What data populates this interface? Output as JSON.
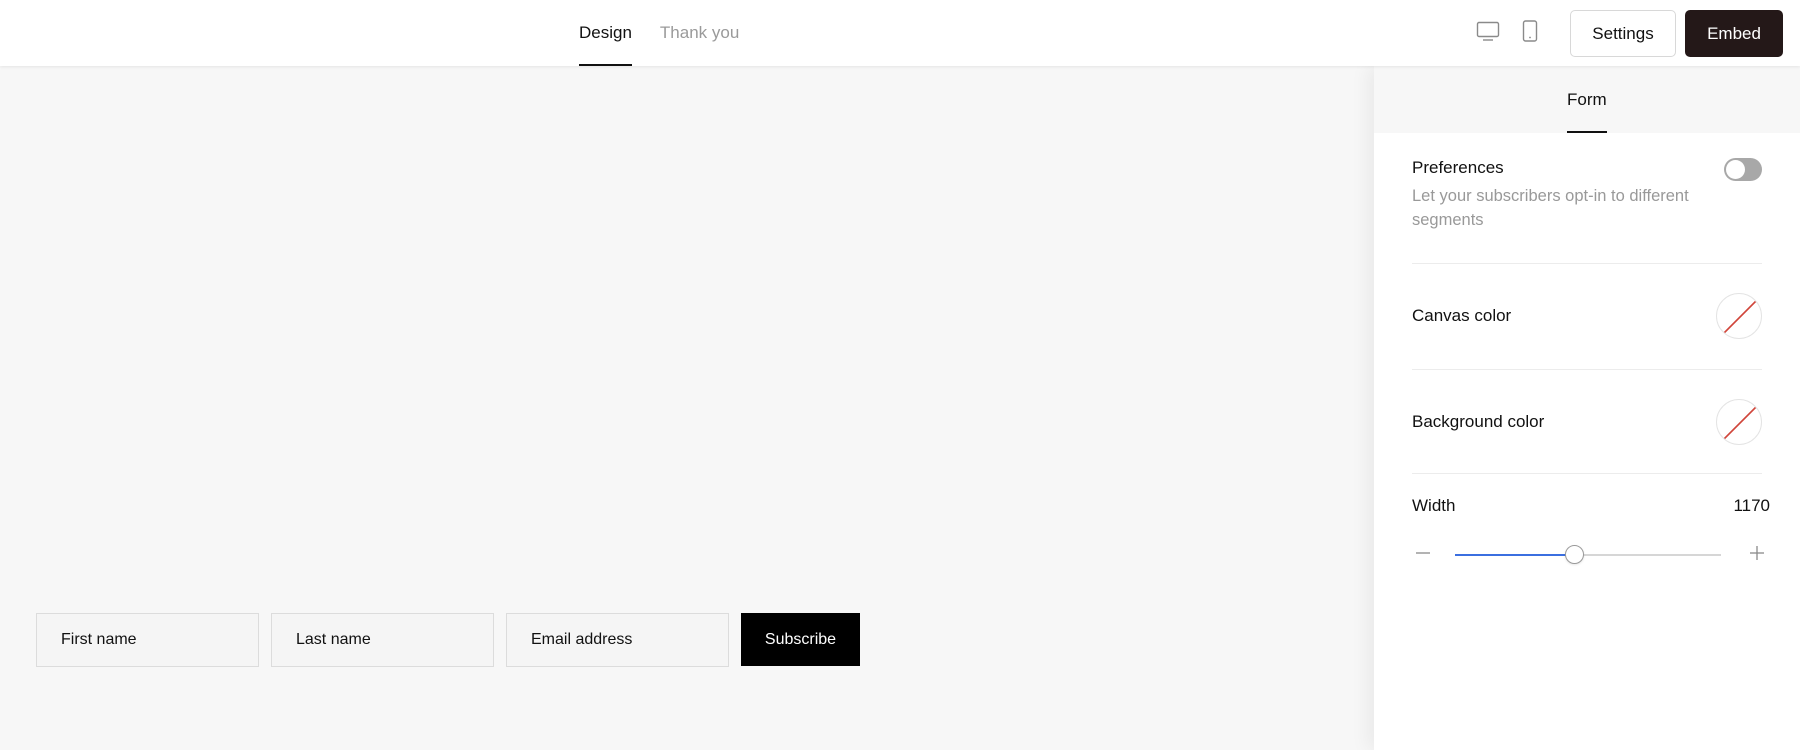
{
  "header": {
    "tabs": [
      {
        "label": "Design",
        "active": true
      },
      {
        "label": "Thank you",
        "active": false
      }
    ],
    "devices": {
      "desktop_icon": "desktop-icon",
      "mobile_icon": "mobile-icon"
    },
    "settings_label": "Settings",
    "embed_label": "Embed"
  },
  "canvas": {
    "form": {
      "first_name_placeholder": "First name",
      "last_name_placeholder": "Last name",
      "email_placeholder": "Email address",
      "subscribe_label": "Subscribe"
    }
  },
  "panel": {
    "tab_label": "Form",
    "preferences": {
      "label": "Preferences",
      "description": "Let your subscribers opt-in to different segments",
      "enabled": false
    },
    "canvas_color": {
      "label": "Canvas color",
      "value": "none"
    },
    "background_color": {
      "label": "Background color",
      "value": "none"
    },
    "width": {
      "label": "Width",
      "value": "1170",
      "slider_fraction": 0.45
    }
  },
  "colors": {
    "accent": "#3b6fe0",
    "embed_bg": "#241818",
    "swatch_slash": "#d0453a"
  }
}
